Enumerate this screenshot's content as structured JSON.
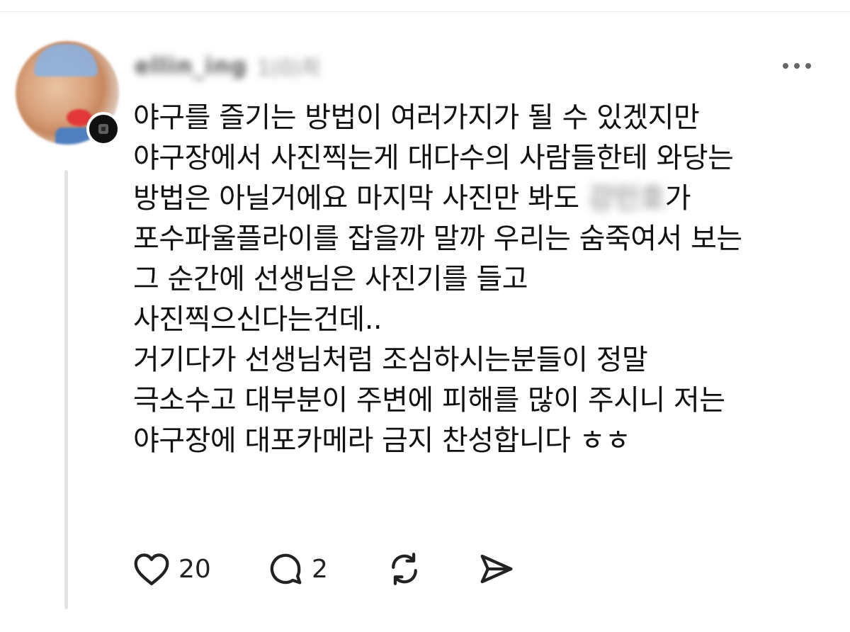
{
  "post": {
    "username_redacted": "ellin_ing",
    "username_suffix_redacted": "1(0)죄",
    "body_lines": [
      {
        "text": "야구를 즐기는 방법이 여러가지가 될 수 있겠지만"
      },
      {
        "text": "야구장에서 사진찍는게 대다수의 사람들한테 와당는"
      },
      {
        "text": "방법은 아닐거에요 마지막 사진만 봐도 ",
        "redacted": "강민호",
        "suffix": "가"
      },
      {
        "text": "포수파울플라이를 잡을까 말까 우리는 숨죽여서 보는"
      },
      {
        "text": "그 순간에 선생님은 사진기를 들고"
      },
      {
        "text": "사진찍으신다는건데.."
      },
      {
        "text": "거기다가 선생님처럼 조심하시는분들이 정말"
      },
      {
        "text": "극소수고 대부분이 주변에 피해를 많이 주시니 저는"
      },
      {
        "text": "야구장에 대포카메라 금지 찬성합니다 ㅎㅎ"
      }
    ]
  },
  "actions": {
    "like_count": "20",
    "reply_count": "2"
  },
  "icons": {
    "more": "more-horizontal-icon",
    "like": "heart-icon",
    "reply": "speech-bubble-icon",
    "repost": "repost-icon",
    "share": "send-icon",
    "avatar_badge": "follow-badge-icon"
  },
  "colors": {
    "text": "#111111",
    "icon": "#222222",
    "thread_line": "#e3e3e3",
    "divider": "#e9e9e9"
  }
}
